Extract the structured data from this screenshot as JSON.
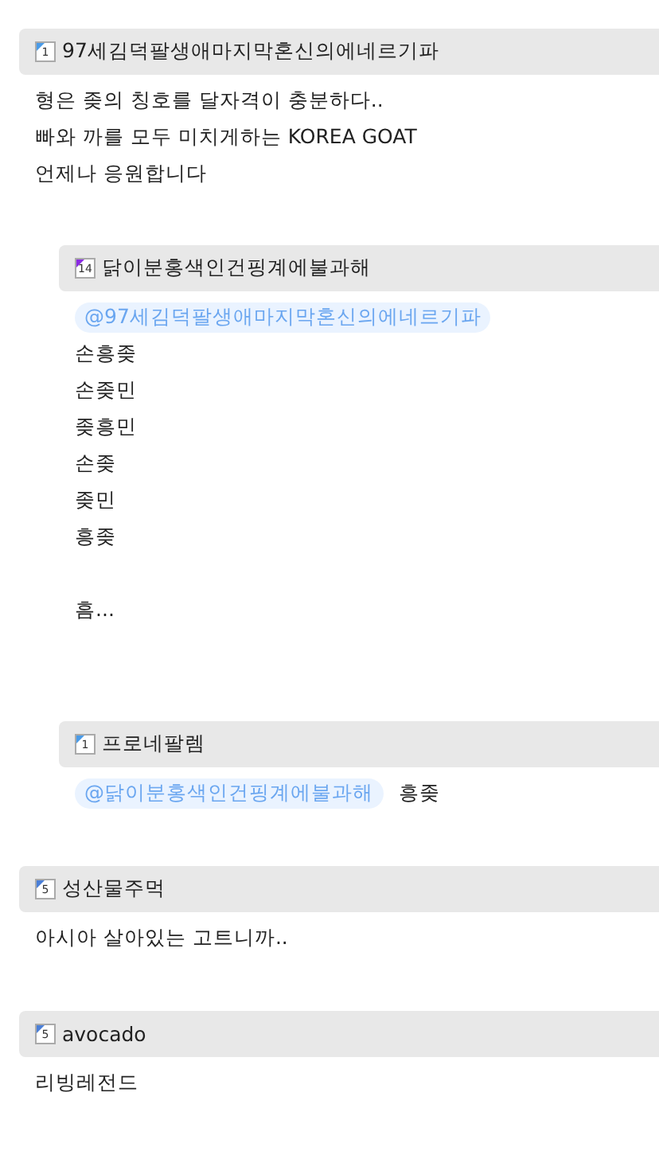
{
  "comments": [
    {
      "author": "97세김덕팔생애마지막혼신의에네르기파",
      "level": "1",
      "color": "#4a9be8",
      "lines": [
        {
          "parts": [
            {
              "kind": "text",
              "text": "형은 좆의 칭호를 달자격이 충분하다.."
            }
          ]
        },
        {
          "parts": [
            {
              "kind": "text",
              "text": "빠와 까를 모두 미치게하는 KOREA GOAT"
            }
          ]
        },
        {
          "parts": [
            {
              "kind": "text",
              "text": "언제나 응원합니다"
            }
          ]
        }
      ],
      "replies": [
        {
          "author": "닭이분홍색인건핑계에불과해",
          "level": "14",
          "color": "#8a2be2",
          "lines": [
            {
              "parts": [
                {
                  "kind": "mention",
                  "text": "@97세김덕팔생애마지막혼신의에네르기파"
                }
              ]
            },
            {
              "parts": [
                {
                  "kind": "text",
                  "text": "손흥좆"
                }
              ]
            },
            {
              "parts": [
                {
                  "kind": "text",
                  "text": "손좆민"
                }
              ]
            },
            {
              "parts": [
                {
                  "kind": "text",
                  "text": "좆흥민"
                }
              ]
            },
            {
              "parts": [
                {
                  "kind": "text",
                  "text": "손좆"
                }
              ]
            },
            {
              "parts": [
                {
                  "kind": "text",
                  "text": "좆민"
                }
              ]
            },
            {
              "parts": [
                {
                  "kind": "text",
                  "text": "흥좆"
                }
              ]
            },
            {
              "gap_before": true,
              "parts": [
                {
                  "kind": "text",
                  "text": "흠..."
                }
              ]
            }
          ]
        },
        {
          "author": "프로네팔렘",
          "level": "1",
          "color": "#4a9be8",
          "lines": [
            {
              "parts": [
                {
                  "kind": "mention",
                  "text": "@닭이분홍색인건핑계에불과해"
                },
                {
                  "kind": "text",
                  "text": "흥좆"
                }
              ]
            }
          ]
        }
      ]
    },
    {
      "author": "성산물주먹",
      "level": "5",
      "color": "#4a7fd8",
      "lines": [
        {
          "parts": [
            {
              "kind": "text",
              "text": "아시아 살아있는 고트니까.."
            }
          ]
        }
      ]
    },
    {
      "author": "avocado",
      "level": "5",
      "color": "#4a7fd8",
      "lines": [
        {
          "parts": [
            {
              "kind": "text",
              "text": "리빙레전드"
            }
          ]
        }
      ]
    }
  ]
}
